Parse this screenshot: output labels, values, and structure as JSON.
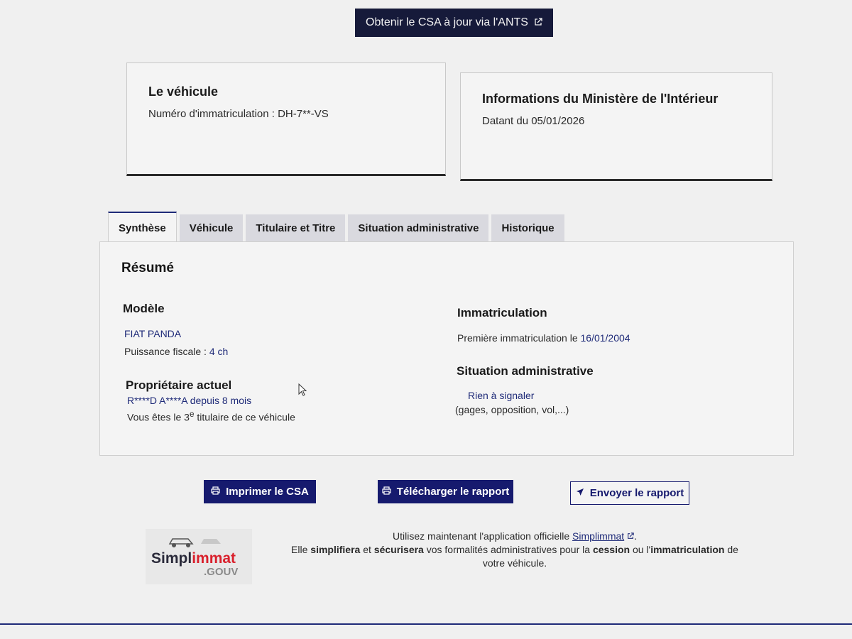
{
  "header": {
    "ants_button_label": "Obtenir le CSA à jour via l'ANTS"
  },
  "vehicle_card": {
    "title": "Le véhicule",
    "registration": "Numéro d'immatriculation : DH-7**-VS"
  },
  "ministry_card": {
    "title": "Informations du Ministère de l'Intérieur",
    "date": "Datant du 05/01/2026"
  },
  "tabs": [
    {
      "label": "Synthèse",
      "active": true
    },
    {
      "label": "Véhicule",
      "active": false
    },
    {
      "label": "Titulaire et Titre",
      "active": false
    },
    {
      "label": "Situation administrative",
      "active": false
    },
    {
      "label": "Historique",
      "active": false
    }
  ],
  "summary": {
    "title": "Résumé",
    "model": {
      "title": "Modèle",
      "name": "FIAT PANDA",
      "power_label": "Puissance fiscale : ",
      "power_value": "4 ch"
    },
    "owner": {
      "title": "Propriétaire actuel",
      "name": "R****D A****A",
      "since": "depuis 8 mois",
      "holder_prefix": "Vous êtes le 3",
      "holder_sup": "e",
      "holder_suffix": " titulaire de ce véhicule"
    },
    "registration": {
      "title": "Immatriculation",
      "first_label": "Première immatriculation le ",
      "first_date": "16/01/2004"
    },
    "admin": {
      "title": "Situation administrative",
      "status": "Rien à signaler",
      "detail": "(gages, opposition, vol,...)"
    }
  },
  "actions": {
    "print_label": "Imprimer le CSA",
    "download_label": "Télécharger le rapport",
    "send_label": "Envoyer le rapport"
  },
  "promo": {
    "logo_main": "Simpl",
    "logo_accent": "immat",
    "logo_gouv": ".GOUV",
    "line1_prefix": "Utilisez maintenant l'application officielle ",
    "line1_link": "Simplimmat",
    "line1_suffix": ".",
    "line2_a": "Elle ",
    "line2_b": "simplifiera",
    "line2_c": " et ",
    "line2_d": "sécurisera",
    "line2_e": " vos formalités administratives pour la ",
    "line2_f": "cession",
    "line2_g": " ou l'",
    "line2_h": "immatriculation",
    "line2_i": " de votre véhicule."
  }
}
